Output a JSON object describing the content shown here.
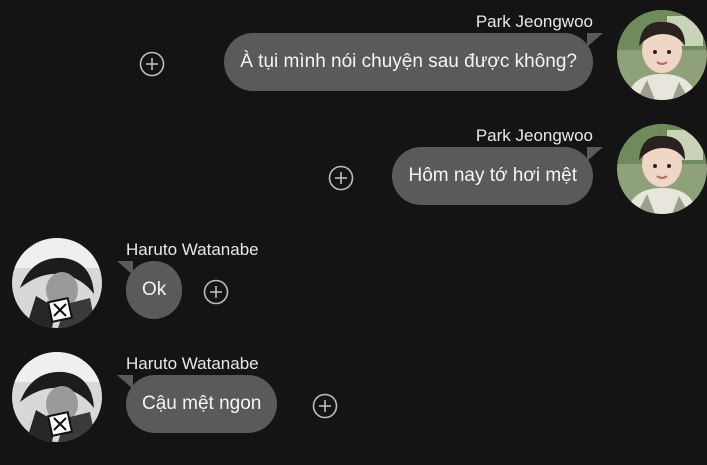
{
  "messages": [
    {
      "sender": "Park Jeongwoo",
      "text": "À tụi mình nói chuyện sau được không?",
      "side": "right",
      "avatar_icon": "avatar-park-jeongwoo"
    },
    {
      "sender": "Park Jeongwoo",
      "text": "Hôm nay tớ hơi mệt",
      "side": "right",
      "avatar_icon": "avatar-park-jeongwoo"
    },
    {
      "sender": "Haruto Watanabe",
      "text": "Ok",
      "side": "left",
      "avatar_icon": "avatar-haruto-watanabe"
    },
    {
      "sender": "Haruto Watanabe",
      "text": "Cậu mệt ngon",
      "side": "left",
      "avatar_icon": "avatar-haruto-watanabe"
    }
  ],
  "colors": {
    "background": "#141414",
    "bubble": "#5a5a5a",
    "text": "#f5f5f5",
    "add_icon": "#bdbdbd"
  }
}
